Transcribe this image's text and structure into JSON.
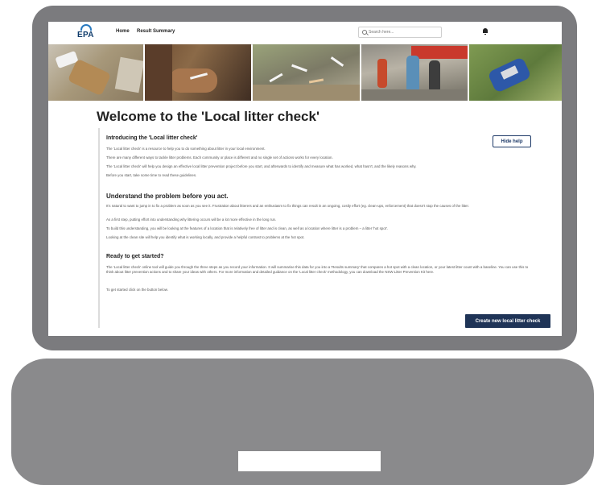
{
  "nav": {
    "logo_text": "EPA",
    "links": [
      "Home",
      "Result Summary"
    ],
    "search_placeholder": "Search here...",
    "icons": {
      "search": "search-icon",
      "bell": "bell-icon"
    }
  },
  "banner": {
    "photos": [
      "litter-paper-photo",
      "cigarette-hands-photo",
      "cigarette-butts-photo",
      "volunteers-street-photo",
      "crushed-can-photo"
    ]
  },
  "page": {
    "title": "Welcome to the 'Local litter check'",
    "hide_help_label": "Hide help",
    "create_label": "Create new local litter check"
  },
  "intro": {
    "heading": "Introducing the 'Local litter check'",
    "paragraphs": [
      "The 'Local litter check' is a resource to help you to do something about litter in your local environment.",
      "There are many different ways to tackle litter problems. Each community or place is different and no single set of actions works for every location.",
      "The 'Local litter check' will help you design an effective local litter prevention project before you start, and afterwards to identify and measure what has worked, what hasn't, and the likely reasons why.",
      "Before you start, take some time to read these guidelines."
    ]
  },
  "understand": {
    "heading": "Understand the problem before you act.",
    "paragraphs": [
      "It's natural to want to jump in to fix a problem as soon as you see it. Frustration about litterers and an enthusiasm to fix things can result in an ongoing, costly effort (eg. clean-ups, enforcement) that doesn't stop the causes of the litter.",
      "As a first step, putting effort into understanding why littering occurs will be a lot more effective in the long run.",
      "To build this understanding, you will be looking at the features of a location that is relatively free of litter and is clean, as well as a location where litter is a problem – a litter 'hot spot'.",
      "Looking at the clean site will help you identify what is working locally, and provide a helpful contrast to problems at the hot spot."
    ]
  },
  "ready": {
    "heading": "Ready to get started?",
    "paragraphs": [
      "The 'Local litter check' online tool will guide you through the three steps as you record your information. It will summarise this data for you into a 'Results summary' that compares a hot spot with a clean location, or your latest litter count with a baseline. You can use this to think about litter prevention actions and to share your ideas with others. For more information and detailed guidance on the 'Local litter check' methodology, you can download the NSW Litter Prevention Kit here.",
      "To get started click on the button below."
    ]
  }
}
